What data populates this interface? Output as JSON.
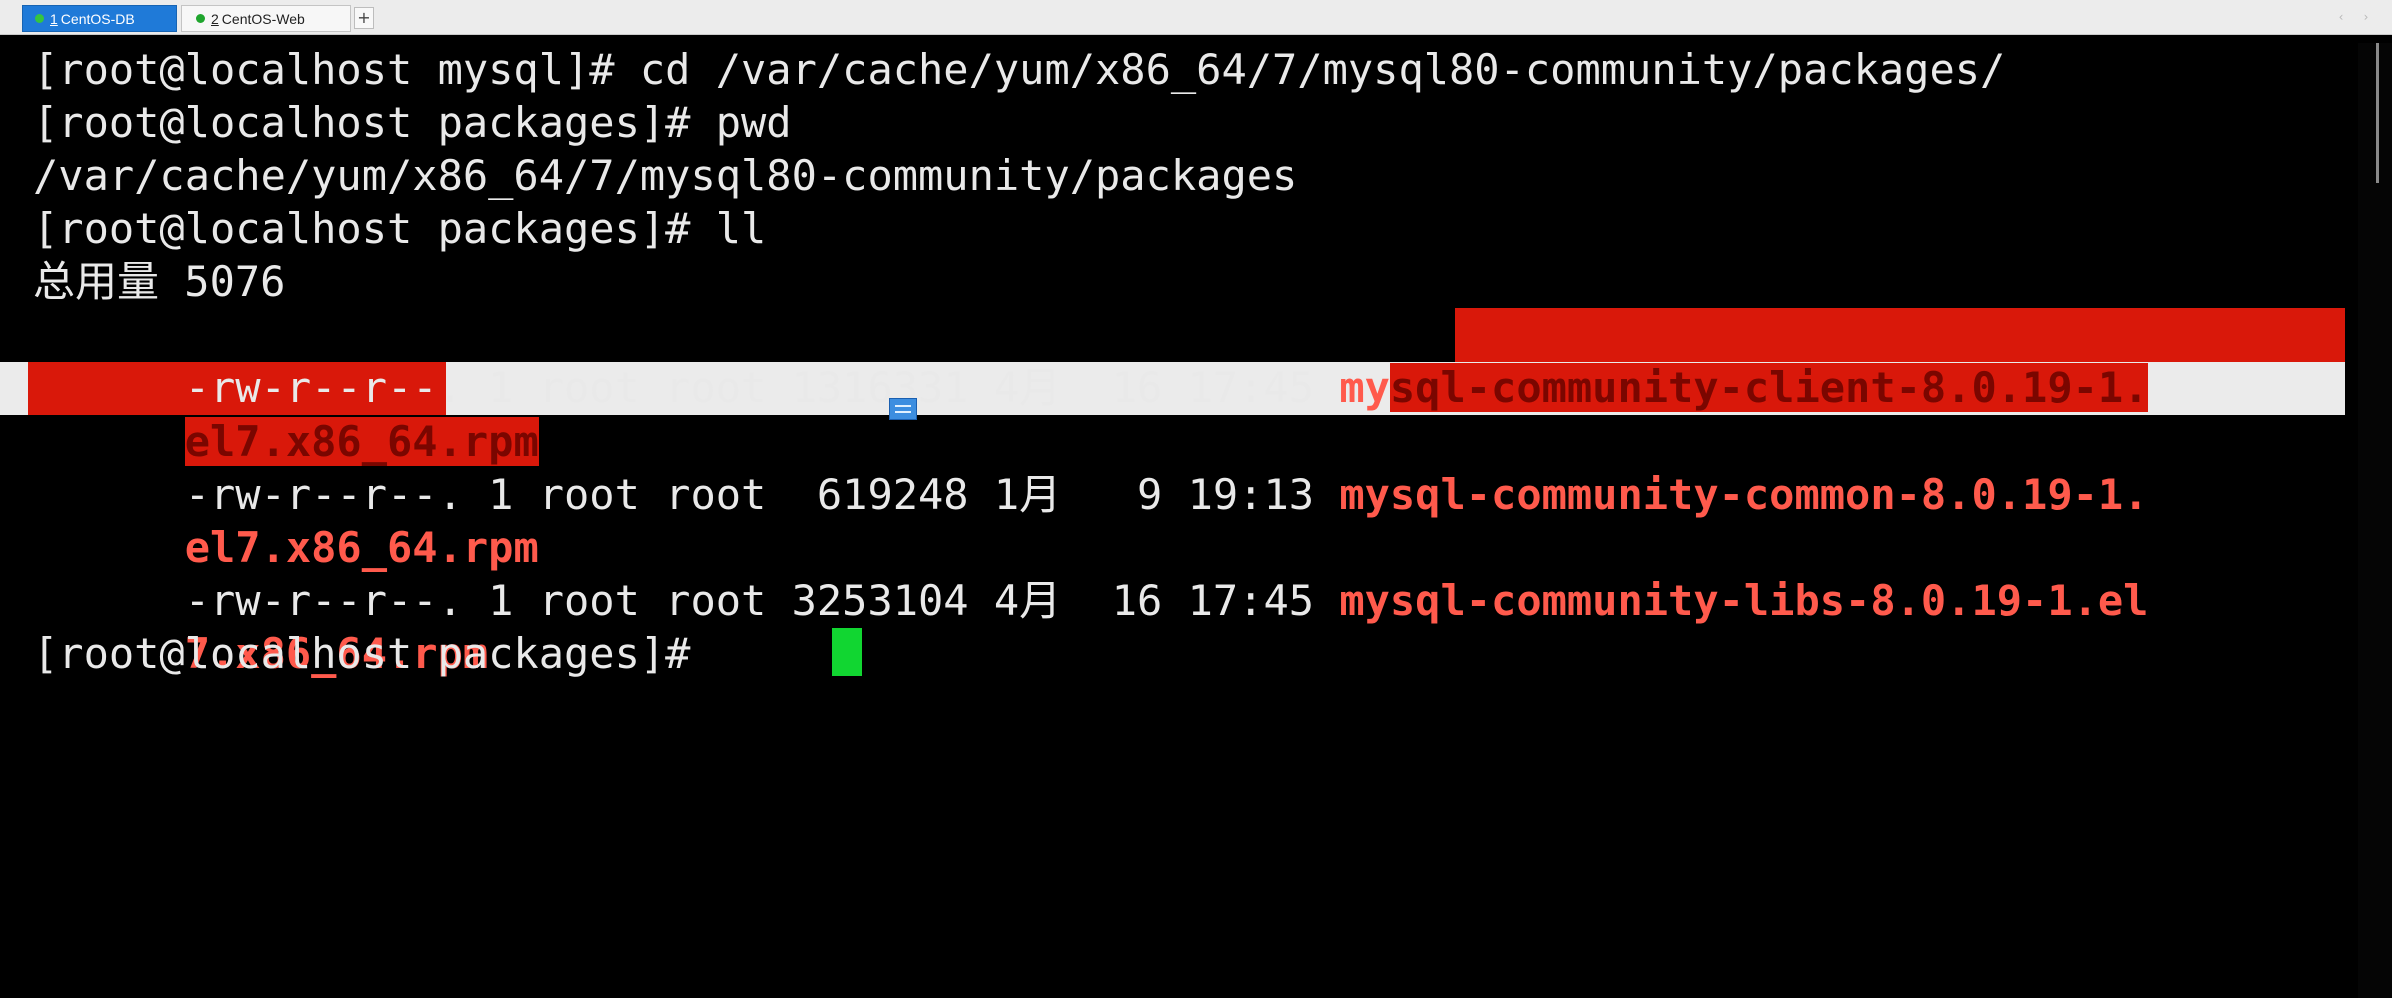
{
  "tabs": [
    {
      "number": "1",
      "label": "CentOS-DB",
      "active": true
    },
    {
      "number": "2",
      "label": "CentOS-Web",
      "active": false
    }
  ],
  "tab_add_label": "+",
  "tab_scroll_left": "‹",
  "tab_scroll_right": "›",
  "terminal": {
    "lines": {
      "l1": "[root@localhost mysql]# cd /var/cache/yum/x86_64/7/mysql80-community/packages/",
      "l2": "[root@localhost packages]# pwd",
      "l3": "/var/cache/yum/x86_64/7/mysql80-community/packages",
      "l4": "[root@localhost packages]# ll",
      "l5": "总用量 5076",
      "l6_meta": "-rw-r--r--. 1 root root 1316331 4月  16 17:45 ",
      "l6_name_a": "my",
      "l6_name_b": "sql-community-client-8.0.19-1.",
      "l7_name": "el7.x86_64.rpm",
      "l8_meta": "-rw-r--r--. 1 root root  619248 1月   9 19:13 ",
      "l8_name": "mysql-community-common-8.0.19-1.",
      "l9_name": "el7.x86_64.rpm",
      "l10_meta": "-rw-r--r--. 1 root root 3253104 4月  16 17:45 ",
      "l10_name": "mysql-community-libs-8.0.19-1.el",
      "l11_name": "7.x86_64.rpm",
      "l12": "[root@localhost packages]# "
    }
  },
  "colors": {
    "background": "#000000",
    "text": "#e9e9e9",
    "rpm_file": "#ff5a4c",
    "selection": "#d9180a",
    "cursor": "#11d631",
    "active_tab": "#1f7ad8"
  }
}
